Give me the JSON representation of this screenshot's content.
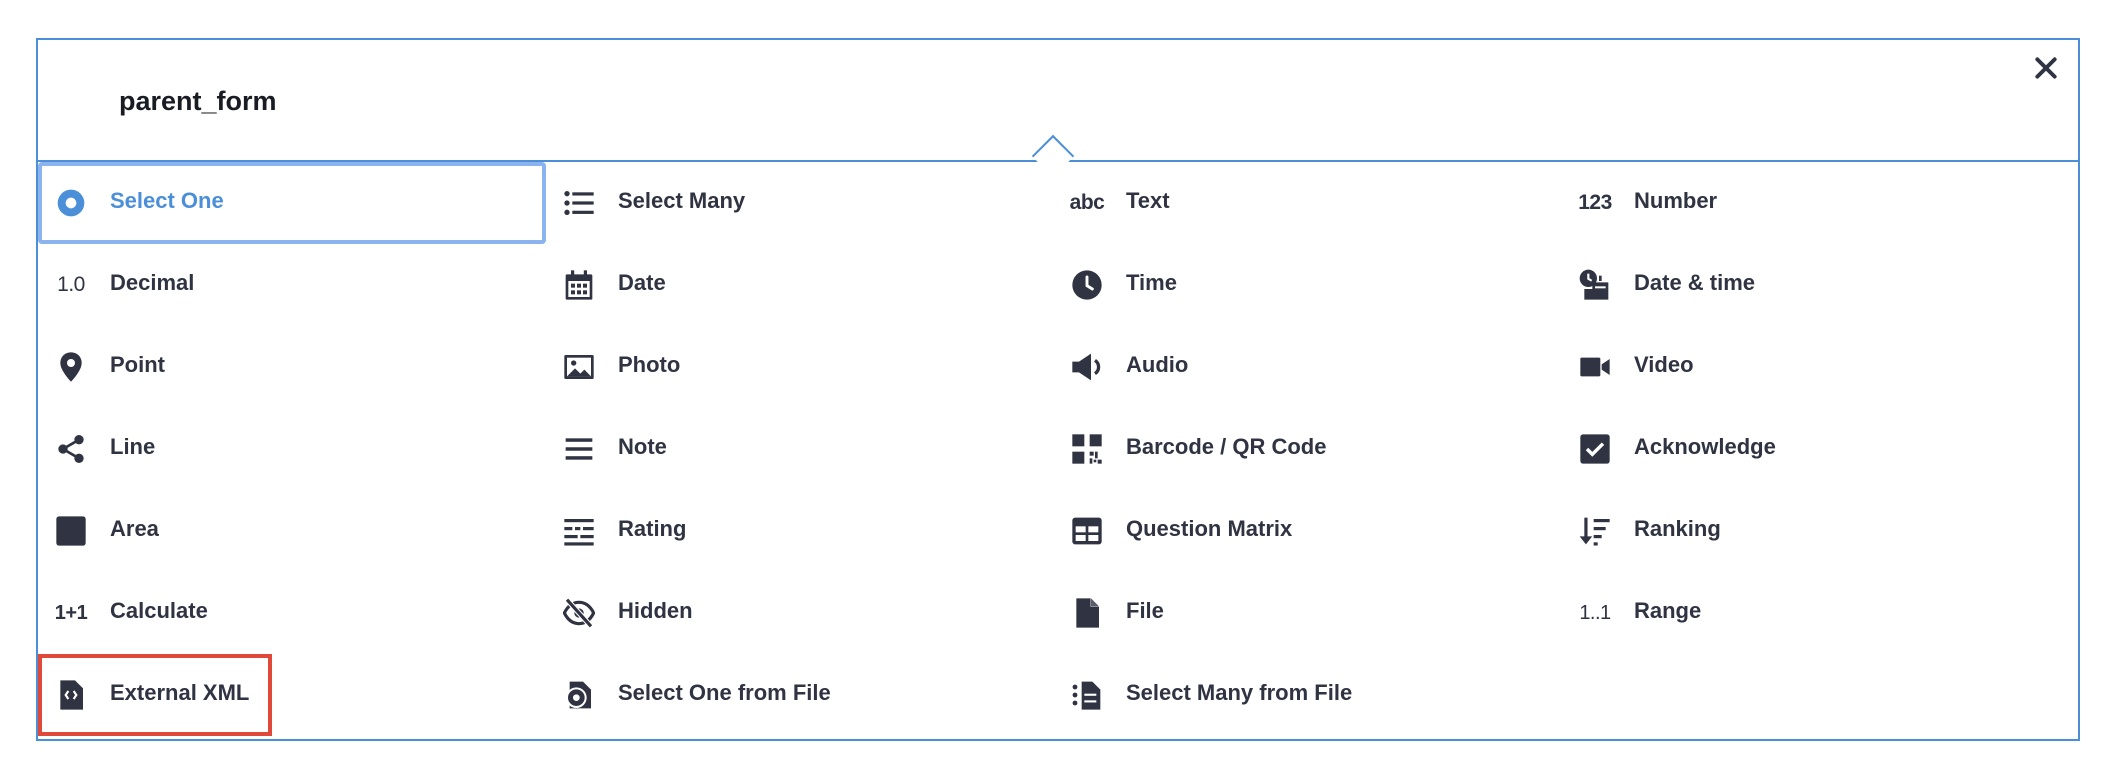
{
  "header": {
    "form_name": "parent_form"
  },
  "icons": {
    "close": "close-icon"
  },
  "colors": {
    "accent": "#4b8fd8",
    "selected_border": "#8ab3f0",
    "highlight_border": "#e0483a",
    "text": "#2f3342"
  },
  "question_types": [
    {
      "label": "Select One",
      "icon": "radio-icon"
    },
    {
      "label": "Select Many",
      "icon": "list-icon"
    },
    {
      "label": "Text",
      "icon": "text-icon",
      "glyph": "abc"
    },
    {
      "label": "Number",
      "icon": "number-icon",
      "glyph": "123"
    },
    {
      "label": "Decimal",
      "icon": "decimal-icon",
      "glyph": "1.0"
    },
    {
      "label": "Date",
      "icon": "calendar-icon"
    },
    {
      "label": "Time",
      "icon": "clock-icon"
    },
    {
      "label": "Date & time",
      "icon": "date-time-icon"
    },
    {
      "label": "Point",
      "icon": "map-pin-icon"
    },
    {
      "label": "Photo",
      "icon": "image-icon"
    },
    {
      "label": "Audio",
      "icon": "speaker-icon"
    },
    {
      "label": "Video",
      "icon": "video-camera-icon"
    },
    {
      "label": "Line",
      "icon": "share-icon"
    },
    {
      "label": "Note",
      "icon": "menu-lines-icon"
    },
    {
      "label": "Barcode / QR Code",
      "icon": "qr-code-icon"
    },
    {
      "label": "Acknowledge",
      "icon": "checkbox-icon"
    },
    {
      "label": "Area",
      "icon": "square-icon"
    },
    {
      "label": "Rating",
      "icon": "rating-icon"
    },
    {
      "label": "Question Matrix",
      "icon": "table-icon"
    },
    {
      "label": "Ranking",
      "icon": "sort-icon"
    },
    {
      "label": "Calculate",
      "icon": "calculate-icon",
      "glyph": "1+1"
    },
    {
      "label": "Hidden",
      "icon": "eye-off-icon"
    },
    {
      "label": "File",
      "icon": "file-icon"
    },
    {
      "label": "Range",
      "icon": "range-icon",
      "glyph": "1..1"
    },
    {
      "label": "External XML",
      "icon": "xml-file-icon"
    },
    {
      "label": "Select One from File",
      "icon": "select-one-file-icon"
    },
    {
      "label": "Select Many from File",
      "icon": "select-many-file-icon"
    }
  ]
}
